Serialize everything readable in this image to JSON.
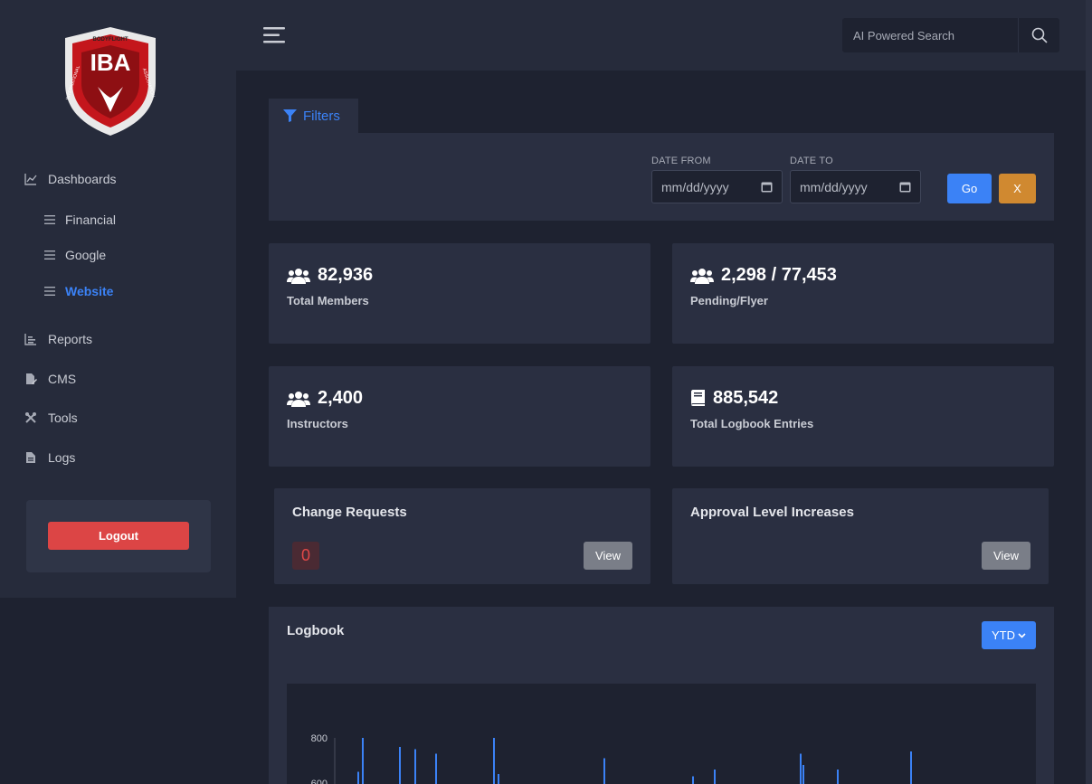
{
  "sidebar": {
    "logo": {
      "top_text": "BODYFLIGHT",
      "main_text": "IBA",
      "left_text": "INTERNATIONAL",
      "right_text": "ASSOCIATION"
    },
    "dashboards": "Dashboards",
    "sub_items": [
      {
        "label": "Financial",
        "active": false
      },
      {
        "label": "Google",
        "active": false
      },
      {
        "label": "Website",
        "active": true
      }
    ],
    "reports": "Reports",
    "cms": "CMS",
    "tools": "Tools",
    "logs": "Logs",
    "logout": "Logout"
  },
  "topbar": {
    "search_placeholder": "AI Powered Search"
  },
  "filters": {
    "tab_label": "Filters",
    "date_from_label": "DATE FROM",
    "date_to_label": "DATE TO",
    "date_from_value": "mm/dd/yyyy",
    "date_to_value": "mm/dd/yyyy",
    "go": "Go",
    "clear": "X"
  },
  "stats": [
    {
      "value": "82,936",
      "label": "Total Members",
      "icon": "users-icon"
    },
    {
      "value": "2,298 / 77,453",
      "label": "Pending/Flyer",
      "icon": "users-icon"
    },
    {
      "value": "2,400",
      "label": "Instructors",
      "icon": "users-icon"
    },
    {
      "value": "885,542",
      "label": "Total Logbook Entries",
      "icon": "book-icon"
    }
  ],
  "change_requests": {
    "title": "Change Requests",
    "count": "0",
    "view": "View"
  },
  "approval_increases": {
    "title": "Approval Level Increases",
    "view": "View"
  },
  "logbook": {
    "title": "Logbook",
    "period": "YTD"
  },
  "chart_data": {
    "type": "bar",
    "title": "",
    "xlabel": "",
    "ylabel": "",
    "y_tick_labels": [
      "800",
      "600"
    ],
    "visible_y_range": [
      600,
      800
    ],
    "values": [
      650,
      800,
      760,
      750,
      730,
      800,
      640,
      710,
      630,
      660,
      730,
      680,
      660,
      740
    ],
    "color": "#3b82f6",
    "grid": false
  },
  "colors": {
    "accent": "#3b82f6",
    "danger": "#dc4545",
    "warning": "#d08930",
    "panel": "#2a2f41",
    "background": "#1e2230"
  }
}
